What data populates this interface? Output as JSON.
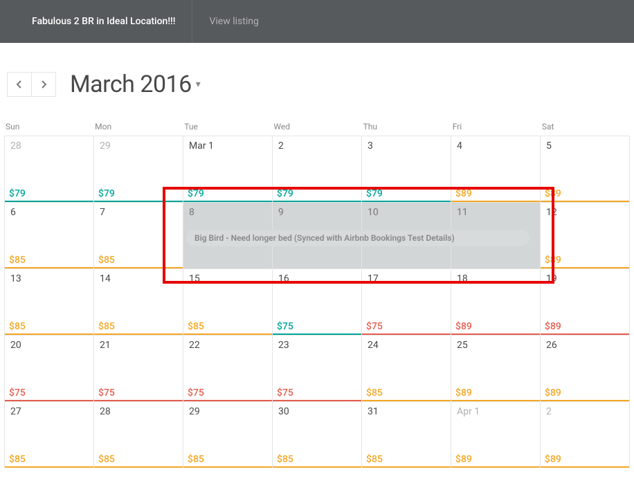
{
  "topbar": {
    "listing_title": "Fabulous 2 BR in Ideal Location!!!",
    "view_listing": "View listing"
  },
  "header": {
    "month_label": "March 2016"
  },
  "dow": [
    "Sun",
    "Mon",
    "Tue",
    "Wed",
    "Thu",
    "Fri",
    "Sat"
  ],
  "event": {
    "label": "Big Bird - Need longer bed (Synced with Airbnb Bookings Test Details)"
  },
  "weeks": [
    [
      {
        "label": "28",
        "type": "prev",
        "price": "$79",
        "pcolor": "teal",
        "ucolor": "u-teal"
      },
      {
        "label": "29",
        "type": "prev",
        "price": "$79",
        "pcolor": "teal",
        "ucolor": "u-teal"
      },
      {
        "label": "Mar 1",
        "type": "cur",
        "price": "$79",
        "pcolor": "teal",
        "ucolor": "u-teal"
      },
      {
        "label": "2",
        "type": "cur",
        "price": "$79",
        "pcolor": "teal",
        "ucolor": "u-teal"
      },
      {
        "label": "3",
        "type": "cur",
        "price": "$79",
        "pcolor": "teal",
        "ucolor": "u-teal"
      },
      {
        "label": "4",
        "type": "cur",
        "price": "$89",
        "pcolor": "orange",
        "ucolor": "u-orange"
      },
      {
        "label": "5",
        "type": "cur",
        "price": "$89",
        "pcolor": "orange",
        "ucolor": "u-orange"
      }
    ],
    [
      {
        "label": "6",
        "type": "cur",
        "price": "$85",
        "pcolor": "orange",
        "ucolor": "u-orange"
      },
      {
        "label": "7",
        "type": "cur",
        "price": "$85",
        "pcolor": "orange",
        "ucolor": "u-orange"
      },
      {
        "label": "8",
        "type": "cur",
        "booked": true,
        "price": "",
        "pcolor": "",
        "ucolor": ""
      },
      {
        "label": "9",
        "type": "cur",
        "booked": true,
        "price": "",
        "pcolor": "",
        "ucolor": ""
      },
      {
        "label": "10",
        "type": "cur",
        "booked": true,
        "price": "",
        "pcolor": "",
        "ucolor": ""
      },
      {
        "label": "11",
        "type": "cur",
        "booked": true,
        "price": "",
        "pcolor": "",
        "ucolor": ""
      },
      {
        "label": "12",
        "type": "cur",
        "price": "$89",
        "pcolor": "orange",
        "ucolor": "u-orange"
      }
    ],
    [
      {
        "label": "13",
        "type": "cur",
        "price": "$85",
        "pcolor": "orange",
        "ucolor": "u-orange"
      },
      {
        "label": "14",
        "type": "cur",
        "price": "$85",
        "pcolor": "orange",
        "ucolor": "u-orange"
      },
      {
        "label": "15",
        "type": "cur",
        "price": "$85",
        "pcolor": "orange",
        "ucolor": "u-orange"
      },
      {
        "label": "16",
        "type": "cur",
        "price": "$75",
        "pcolor": "teal",
        "ucolor": "u-teal"
      },
      {
        "label": "17",
        "type": "cur",
        "price": "$75",
        "pcolor": "redtx",
        "ucolor": "u-red"
      },
      {
        "label": "18",
        "type": "cur",
        "price": "$89",
        "pcolor": "redtx",
        "ucolor": "u-red"
      },
      {
        "label": "19",
        "type": "cur",
        "price": "$89",
        "pcolor": "redtx",
        "ucolor": "u-red"
      }
    ],
    [
      {
        "label": "20",
        "type": "cur",
        "price": "$75",
        "pcolor": "redtx",
        "ucolor": "u-red"
      },
      {
        "label": "21",
        "type": "cur",
        "price": "$75",
        "pcolor": "redtx",
        "ucolor": "u-red"
      },
      {
        "label": "22",
        "type": "cur",
        "price": "$75",
        "pcolor": "redtx",
        "ucolor": "u-red"
      },
      {
        "label": "23",
        "type": "cur",
        "price": "$75",
        "pcolor": "redtx",
        "ucolor": "u-red"
      },
      {
        "label": "24",
        "type": "cur",
        "price": "$85",
        "pcolor": "orange",
        "ucolor": "u-orange"
      },
      {
        "label": "25",
        "type": "cur",
        "price": "$89",
        "pcolor": "orange",
        "ucolor": "u-orange"
      },
      {
        "label": "26",
        "type": "cur",
        "price": "$89",
        "pcolor": "orange",
        "ucolor": "u-orange"
      }
    ],
    [
      {
        "label": "27",
        "type": "cur",
        "price": "$85",
        "pcolor": "orange",
        "ucolor": "u-orange"
      },
      {
        "label": "28",
        "type": "cur",
        "price": "$85",
        "pcolor": "orange",
        "ucolor": "u-orange"
      },
      {
        "label": "29",
        "type": "cur",
        "price": "$85",
        "pcolor": "orange",
        "ucolor": "u-orange"
      },
      {
        "label": "30",
        "type": "cur",
        "price": "$85",
        "pcolor": "orange",
        "ucolor": "u-orange"
      },
      {
        "label": "31",
        "type": "cur",
        "price": "$85",
        "pcolor": "orange",
        "ucolor": "u-orange"
      },
      {
        "label": "Apr 1",
        "type": "next",
        "price": "$89",
        "pcolor": "orange",
        "ucolor": "u-orange"
      },
      {
        "label": "2",
        "type": "next",
        "price": "$89",
        "pcolor": "orange",
        "ucolor": "u-orange"
      }
    ]
  ]
}
